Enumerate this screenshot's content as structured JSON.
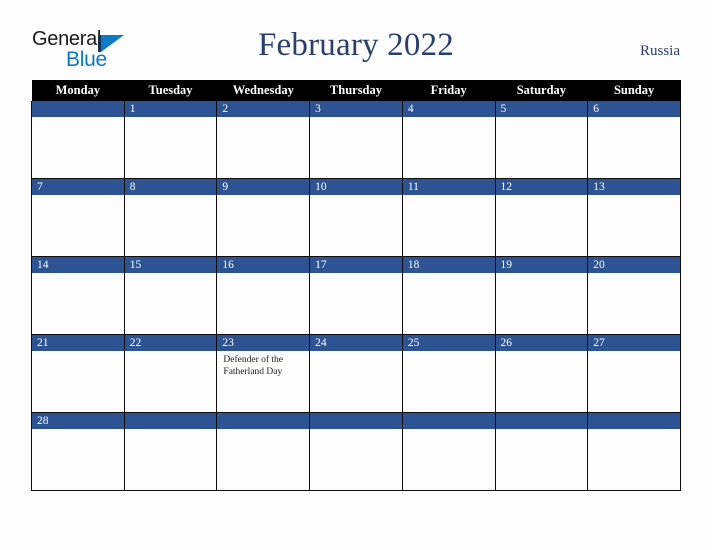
{
  "brand": {
    "name_part1": "General",
    "name_part2": "Blue",
    "triangle_icon": "brand-triangle-icon",
    "primary_color": "#0b79c4",
    "dark_color": "#18314f"
  },
  "header": {
    "title": "February 2022",
    "country": "Russia",
    "title_color": "#28406b"
  },
  "calendar": {
    "month": "February",
    "year": "2022",
    "week_start": "Monday",
    "weekday_headers": [
      "Monday",
      "Tuesday",
      "Wednesday",
      "Thursday",
      "Friday",
      "Saturday",
      "Sunday"
    ],
    "header_bg": "#000000",
    "daynum_band_color": "#2e5392",
    "grid_line_color": "#0d0d0d",
    "weeks": [
      [
        {
          "day": "",
          "events": []
        },
        {
          "day": "1",
          "events": []
        },
        {
          "day": "2",
          "events": []
        },
        {
          "day": "3",
          "events": []
        },
        {
          "day": "4",
          "events": []
        },
        {
          "day": "5",
          "events": []
        },
        {
          "day": "6",
          "events": []
        }
      ],
      [
        {
          "day": "7",
          "events": []
        },
        {
          "day": "8",
          "events": []
        },
        {
          "day": "9",
          "events": []
        },
        {
          "day": "10",
          "events": []
        },
        {
          "day": "11",
          "events": []
        },
        {
          "day": "12",
          "events": []
        },
        {
          "day": "13",
          "events": []
        }
      ],
      [
        {
          "day": "14",
          "events": []
        },
        {
          "day": "15",
          "events": []
        },
        {
          "day": "16",
          "events": []
        },
        {
          "day": "17",
          "events": []
        },
        {
          "day": "18",
          "events": []
        },
        {
          "day": "19",
          "events": []
        },
        {
          "day": "20",
          "events": []
        }
      ],
      [
        {
          "day": "21",
          "events": []
        },
        {
          "day": "22",
          "events": []
        },
        {
          "day": "23",
          "events": [
            "Defender of the Fatherland Day"
          ]
        },
        {
          "day": "24",
          "events": []
        },
        {
          "day": "25",
          "events": []
        },
        {
          "day": "26",
          "events": []
        },
        {
          "day": "27",
          "events": []
        }
      ],
      [
        {
          "day": "28",
          "events": []
        },
        {
          "day": "",
          "events": []
        },
        {
          "day": "",
          "events": []
        },
        {
          "day": "",
          "events": []
        },
        {
          "day": "",
          "events": []
        },
        {
          "day": "",
          "events": []
        },
        {
          "day": "",
          "events": []
        }
      ]
    ]
  }
}
